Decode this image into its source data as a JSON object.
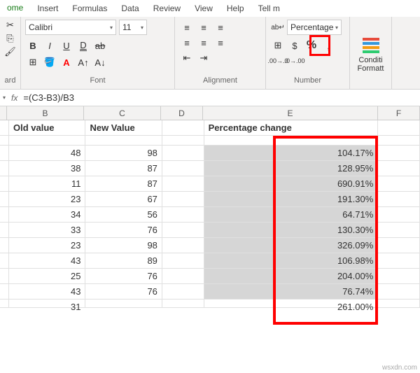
{
  "tabs": {
    "home": "ome",
    "insert": "Insert",
    "formulas": "Formulas",
    "data": "Data",
    "review": "Review",
    "view": "View",
    "help": "Help",
    "tellme": "Tell m"
  },
  "groups": {
    "clipboard": "ard",
    "font": "Font",
    "alignment": "Alignment",
    "number": "Number",
    "styles": ""
  },
  "font": {
    "name": "Calibri",
    "size": "11"
  },
  "numfmt": {
    "value": "Percentage"
  },
  "styles": {
    "condfmt": "Conditi\nFormatt"
  },
  "formula_bar": {
    "fx": "fx",
    "formula": "=(C3-B3)/B3"
  },
  "cols": {
    "b": "B",
    "c": "C",
    "d": "D",
    "e": "E",
    "f": "F"
  },
  "headers": {
    "old": "Old value",
    "new": "New Value",
    "pct": "Percentage change"
  },
  "chart_data": {
    "type": "table",
    "title": "Percentage change",
    "series": [
      {
        "name": "Old value",
        "values": [
          48,
          38,
          11,
          23,
          34,
          33,
          23,
          43,
          25,
          43,
          31
        ]
      },
      {
        "name": "New Value",
        "values": [
          98,
          87,
          87,
          67,
          56,
          76,
          98,
          89,
          76,
          76,
          ""
        ]
      },
      {
        "name": "Percentage change",
        "values": [
          "104.17%",
          "128.95%",
          "690.91%",
          "191.30%",
          "64.71%",
          "130.30%",
          "326.09%",
          "106.98%",
          "204.00%",
          "76.74%",
          "261.00%"
        ]
      }
    ]
  },
  "rows": [
    {
      "b": "48",
      "c": "98",
      "e": "104.17%"
    },
    {
      "b": "38",
      "c": "87",
      "e": "128.95%"
    },
    {
      "b": "11",
      "c": "87",
      "e": "690.91%"
    },
    {
      "b": "23",
      "c": "67",
      "e": "191.30%"
    },
    {
      "b": "34",
      "c": "56",
      "e": "64.71%"
    },
    {
      "b": "33",
      "c": "76",
      "e": "130.30%"
    },
    {
      "b": "23",
      "c": "98",
      "e": "326.09%"
    },
    {
      "b": "43",
      "c": "89",
      "e": "106.98%"
    },
    {
      "b": "25",
      "c": "76",
      "e": "204.00%"
    },
    {
      "b": "43",
      "c": "76",
      "e": "76.74%"
    },
    {
      "b": "31",
      "c": "",
      "e": "261.00%"
    }
  ],
  "watermark": "wsxdn.com"
}
